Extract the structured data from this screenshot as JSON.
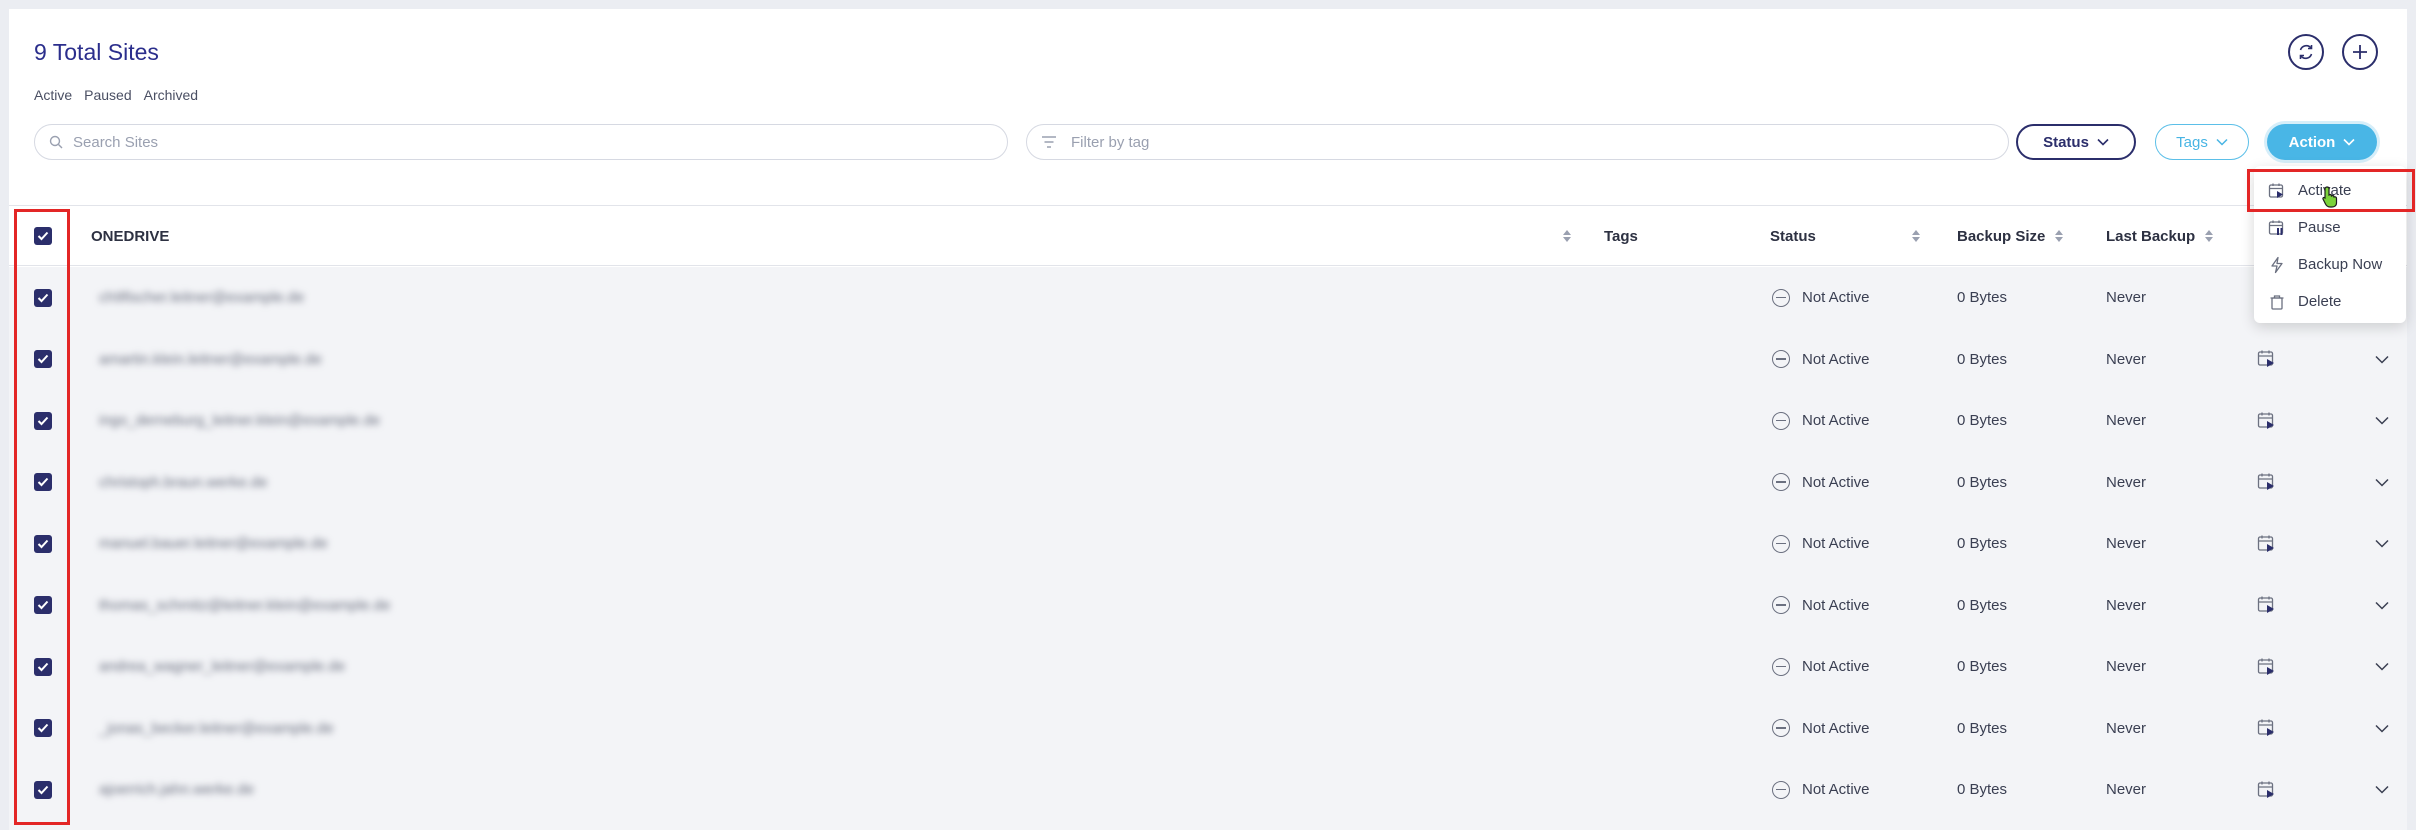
{
  "header": {
    "title": "9 Total Sites",
    "filters": [
      "Active",
      "Paused",
      "Archived"
    ]
  },
  "toolbar": {
    "search_placeholder": "Search Sites",
    "tag_placeholder": "Filter by tag",
    "status_label": "Status",
    "tags_label": "Tags",
    "action_label": "Action"
  },
  "action_menu": {
    "items": [
      "Activate",
      "Pause",
      "Backup Now",
      "Delete"
    ]
  },
  "table": {
    "columns": [
      "ONEDRIVE",
      "Tags",
      "Status",
      "Backup Size",
      "Last Backup"
    ],
    "rows": [
      {
        "site": "ch9fischer.leitner@example.de",
        "status": "Not Active",
        "size": "0 Bytes",
        "last": "Never"
      },
      {
        "site": "amartin.klein.leitner@example.de",
        "status": "Not Active",
        "size": "0 Bytes",
        "last": "Never"
      },
      {
        "site": "ingo_derneburg_leitner.klein@example.de",
        "status": "Not Active",
        "size": "0 Bytes",
        "last": "Never"
      },
      {
        "site": "christoph.braun.werke.de",
        "status": "Not Active",
        "size": "0 Bytes",
        "last": "Never"
      },
      {
        "site": "manuel.bauer.leitner@example.de",
        "status": "Not Active",
        "size": "0 Bytes",
        "last": "Never"
      },
      {
        "site": "thomas_schmitz@leitner.klein@example.de",
        "status": "Not Active",
        "size": "0 Bytes",
        "last": "Never"
      },
      {
        "site": "andrea_wagner_leitner@example.de",
        "status": "Not Active",
        "size": "0 Bytes",
        "last": "Never"
      },
      {
        "site": "_jonas_becker.leitner@example.de",
        "status": "Not Active",
        "size": "0 Bytes",
        "last": "Never"
      },
      {
        "site": "ajoerrich.jahn.werke.de",
        "status": "Not Active",
        "size": "0 Bytes",
        "last": "Never"
      }
    ]
  },
  "colors": {
    "navy": "#2b2e6b",
    "accent": "#49b6e6",
    "highlight": "#e32626"
  }
}
